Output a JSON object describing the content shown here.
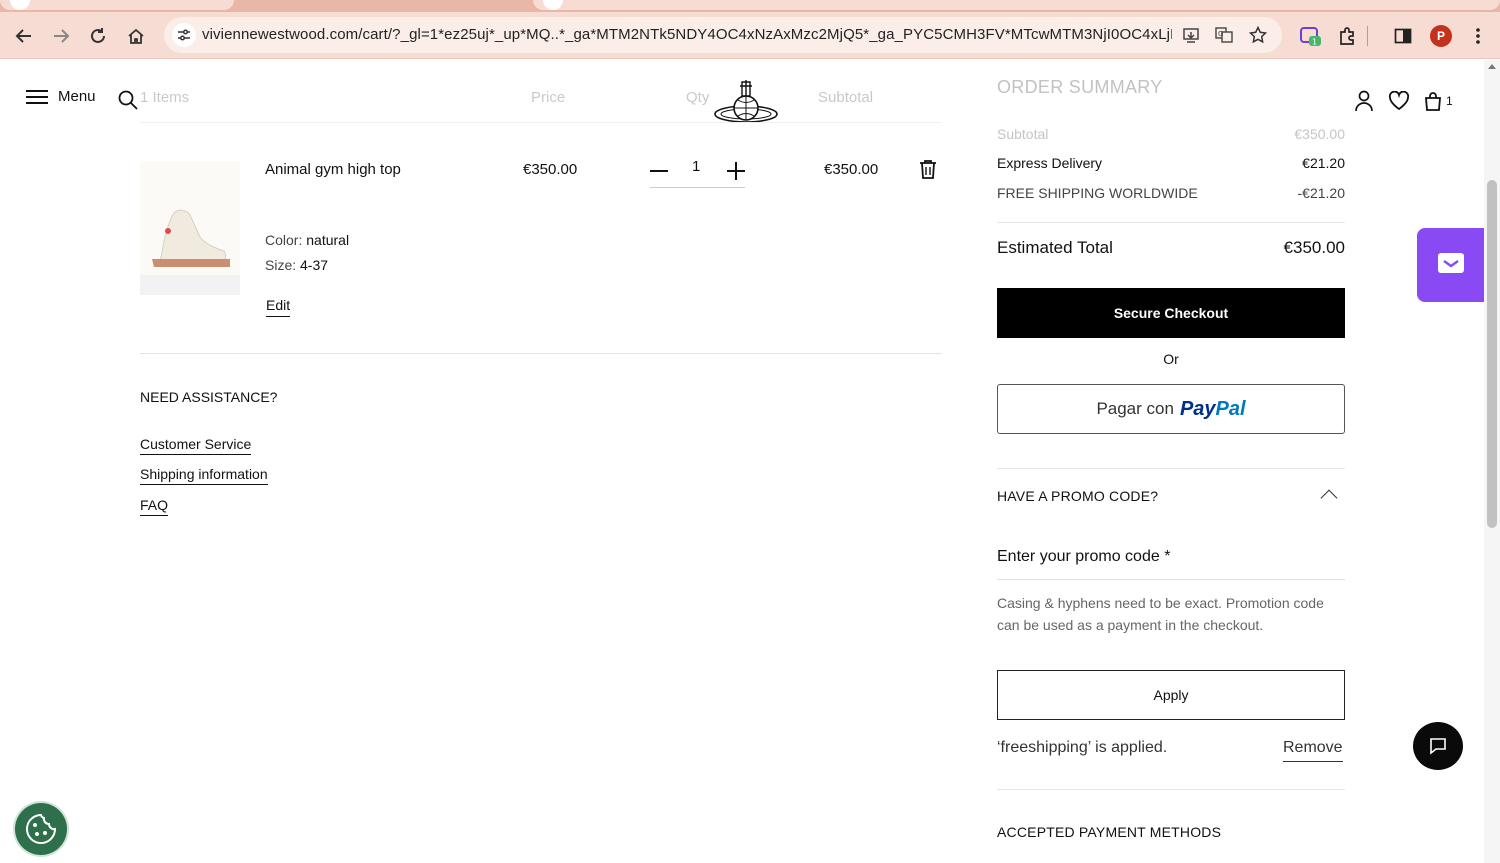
{
  "browser": {
    "url": "viviennewestwood.com/cart/?_gl=1*ez25uj*_up*MQ..*_ga*MTM2NTk5NDY4OC4xNzAxMzc2MjQ5*_ga_PYC5CMH3FV*MTcwMTM3NjI0OC4xLjEuMTcw...",
    "profile_initial": "P",
    "extension_badge": "1"
  },
  "header": {
    "menu_label": "Menu",
    "col_items": "1 Items",
    "col_price": "Price",
    "col_qty": "Qty",
    "col_subtotal": "Subtotal",
    "bag_count": "1"
  },
  "cart": {
    "item": {
      "name": "Animal gym high top",
      "price": "€350.00",
      "qty": "1",
      "subtotal": "€350.00",
      "color_label": "Color:",
      "color_value": "natural",
      "size_label": "Size:",
      "size_value": "4-37",
      "edit_label": "Edit"
    }
  },
  "assistance": {
    "title": "NEED ASSISTANCE?",
    "links": [
      "Customer Service",
      "Shipping information",
      "FAQ"
    ]
  },
  "summary": {
    "title": "ORDER SUMMARY",
    "subtotal_label": "Subtotal",
    "subtotal_value": "€350.00",
    "delivery_label": "Express Delivery",
    "delivery_value": "€21.20",
    "free_label": "FREE SHIPPING WORLDWIDE",
    "free_value": "-€21.20",
    "total_label": "Estimated Total",
    "total_value": "€350.00",
    "checkout_label": "Secure Checkout",
    "or_label": "Or",
    "paypal_prefix": "Pagar con",
    "paypal_brand_1": "Pay",
    "paypal_brand_2": "Pal",
    "promo_title": "HAVE A PROMO CODE?",
    "promo_placeholder": "Enter your promo code *",
    "promo_note": "Casing & hyphens need to be exact. Promotion code can be used as a payment in the checkout.",
    "apply_label": "Apply",
    "applied_text": "‘freeshipping’  is applied.",
    "remove_label": "Remove",
    "accepted_title": "ACCEPTED PAYMENT METHODS"
  },
  "colors": {
    "chrome_bg": "#f6dcd2",
    "tabstrip_bg": "#e8b7a6",
    "widget_purple": "#8a4af3",
    "cookie_green": "#2e6f4c",
    "paypal_dark": "#003087",
    "paypal_light": "#0079c1"
  },
  "icons": [
    "back-arrow-icon",
    "forward-arrow-icon",
    "reload-icon",
    "home-icon",
    "site-settings-icon",
    "install-icon",
    "translate-icon",
    "star-icon",
    "extension-icon",
    "puzzle-icon",
    "side-panel-icon",
    "kebab-menu-icon",
    "hamburger-icon",
    "search-icon",
    "orb-logo-icon",
    "account-icon",
    "heart-icon",
    "bag-icon",
    "trash-icon",
    "chevron-up-icon",
    "chat-icon",
    "cookie-icon"
  ]
}
